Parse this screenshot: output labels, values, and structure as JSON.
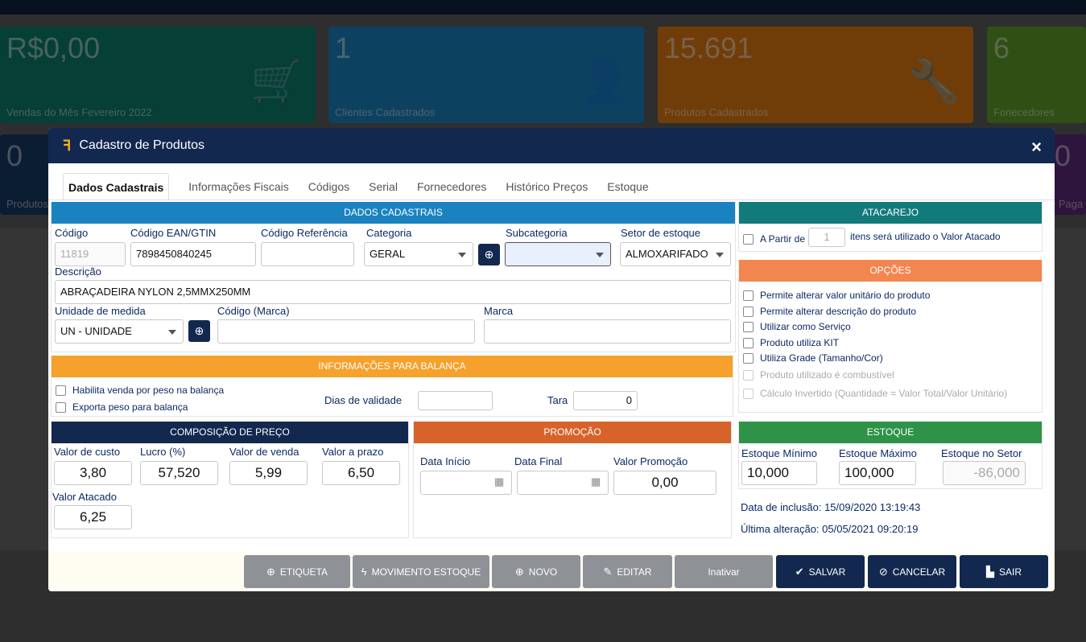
{
  "cards": [
    {
      "value": "R$0,00",
      "label": "Vendas do Mês Fevereiro 2022",
      "color": "#0a7f6b",
      "icon": "cart-icon",
      "glyph": "🛒"
    },
    {
      "value": "1",
      "label": "Clientes Cadastrados",
      "color": "#1b82c0",
      "icon": "user-icon",
      "glyph": "👤"
    },
    {
      "value": "15.691",
      "label": "Produtos Cadastrados",
      "color": "#e07a12",
      "icon": "wrench-icon",
      "glyph": "🔧"
    },
    {
      "value": "6",
      "label": "Fonecedores",
      "color": "#5f9e28",
      "icon": "",
      "glyph": ""
    }
  ],
  "cards2": [
    {
      "value": "0",
      "label": "Produtos",
      "color": "#143a66"
    },
    {
      "value": "0",
      "label": "e Paga",
      "color": "#5a2a7a"
    }
  ],
  "modal": {
    "title": "Cadastro de Produtos",
    "close": "×",
    "tabs": [
      "Dados Cadastrais",
      "Informações Fiscais",
      "Códigos",
      "Serial",
      "Fornecedores",
      "Histórico Preços",
      "Estoque"
    ]
  },
  "dados": {
    "header": "DADOS CADASTRAIS",
    "codigo_label": "Código",
    "codigo": "11819",
    "ean_label": "Código EAN/GTIN",
    "ean": "7898450840245",
    "ref_label": "Código Referência",
    "ref": "",
    "categoria_label": "Categoria",
    "categoria": "GERAL",
    "subcategoria_label": "Subcategoria",
    "subcategoria": "",
    "setor_label": "Setor de estoque",
    "setor": "ALMOXARIFADO",
    "descricao_label": "Descrição",
    "descricao": "ABRAÇADEIRA NYLON 2,5MMX250MM",
    "unidade_label": "Unidade de medida",
    "unidade": "UN - UNIDADE",
    "codmarca_label": "Código (Marca)",
    "codmarca": "",
    "marca_label": "Marca",
    "marca": ""
  },
  "balanca": {
    "header": "INFORMAÇÕES PARA BALANÇA",
    "chk1": "Habilita venda por peso na balança",
    "chk2": "Exporta peso para balança",
    "dias_label": "Dias de validade",
    "dias": "",
    "tara_label": "Tara",
    "tara": "0"
  },
  "preco": {
    "header": "COMPOSIÇÃO DE PREÇO",
    "custo_label": "Valor de custo",
    "custo": "3,80",
    "lucro_label": "Lucro (%)",
    "lucro": "57,520",
    "venda_label": "Valor de venda",
    "venda": "5,99",
    "prazo_label": "Valor a prazo",
    "prazo": "6,50",
    "atacado_label": "Valor Atacado",
    "atacado": "6,25"
  },
  "promocao": {
    "header": "PROMOÇÃO",
    "inicio_label": "Data Início",
    "inicio": "",
    "final_label": "Data Final",
    "final": "",
    "valor_label": "Valor Promoção",
    "valor": "0,00"
  },
  "atacarejo": {
    "header": "ATACAREJO",
    "prefix": "A Partir de",
    "qty": "1",
    "suffix": "itens será utilizado o Valor Atacado"
  },
  "opcoes": {
    "header": "OPÇÕES",
    "items": [
      "Permite alterar valor unitário do produto",
      "Permite alterar descrição do produto",
      "Utilizar como Serviço",
      "Produto utiliza KIT",
      "Utiliza Grade (Tamanho/Cor)",
      "Produto utilizado é combustível",
      "Cálculo Invertido (Quantidade = Valor Total/Valor Unitário)"
    ]
  },
  "estoque": {
    "header": "ESTOQUE",
    "min_label": "Estoque Mínimo",
    "min": "10,000",
    "max_label": "Estoque Máximo",
    "max": "100,000",
    "setor_label": "Estoque no Setor",
    "setor": "-86,000",
    "inclusao": "Data de inclusão: 15/09/2020 13:19:43",
    "alteracao": "Última alteração: 05/05/2021 09:20:19"
  },
  "buttons": {
    "etiqueta": "ETIQUETA",
    "movimento": "MOVIMENTO ESTOQUE",
    "novo": "NOVO",
    "editar": "EDITAR",
    "inativar": "Inativar",
    "salvar": "SALVAR",
    "cancelar": "CANCELAR",
    "sair": "SAIR"
  }
}
